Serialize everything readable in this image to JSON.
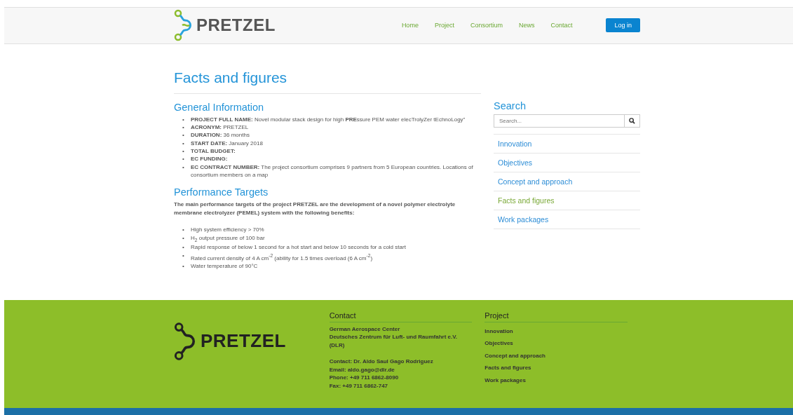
{
  "header": {
    "logo": "PRETZEL",
    "nav": [
      "Home",
      "Project",
      "Consortium",
      "News",
      "Contact"
    ],
    "login": "Log in"
  },
  "page_title": "Facts and figures",
  "general": {
    "heading": "General Information",
    "bullet": "•",
    "items": [
      "**PROJECT FULL NAME:** Novel modular stack design for high **PRE**ssure PEM water elecTrolyZer tEchnoLogy\"",
      "**ACRONYM:** PRETZEL",
      "**DURATION:** 36 months",
      "**START DATE:** January 2018",
      "**TOTAL BUDGET:**",
      "**EC FUNDING:**",
      "**EC CONTRACT NUMBER:** The project consortium comprises 9 partners from 5 European countries. Locations of consortium members on a map"
    ]
  },
  "performance": {
    "heading": "Performance Targets",
    "intro": "The main performance targets of the project PRETZEL are the development of a novel polymer electrolyte membrane electrolyzer (PEMEL) system with the following benefits:",
    "bullet": "•",
    "items": [
      "High system efficiency > 70%",
      "H$_{2}$ output pressure of 100 bar",
      "Rapid response of below 1 second for a hot start and below 10 seconds for a cold start",
      "Rated current density of 4 A cm$^{-2}$ (ability for 1.5 times overload (6 A cm$^{-2}$)",
      "Water temperature of 90°C"
    ]
  },
  "sidebar": {
    "heading": "Search",
    "search": {
      "placeholder": "Search..."
    },
    "items": [
      {
        "label": "Innovation",
        "selected": false
      },
      {
        "label": "Objectives",
        "selected": false
      },
      {
        "label": "Concept and approach",
        "selected": false
      },
      {
        "label": "Facts and figures",
        "selected": true
      },
      {
        "label": "Work packages",
        "selected": false
      }
    ]
  },
  "footer": {
    "logo": "PRETZEL",
    "contact": {
      "heading": "Contact",
      "address": [
        "German Aerospace Center",
        "Deutsches Zentrum für Luft- und Raumfahrt e.V. (DLR)"
      ],
      "details": [
        "**Contact:** Dr. Aldo Saul Gago Rodriguez",
        "**Email:** aldo.gago@dlr.de",
        "**Phone:** +49 711 6862-8090",
        "**Fax:** +49 711 6862-747"
      ]
    },
    "project": {
      "heading": "Project",
      "links": [
        "Innovation",
        "Objectives",
        "Concept and approach",
        "Facts and figures",
        "Work packages"
      ]
    }
  }
}
